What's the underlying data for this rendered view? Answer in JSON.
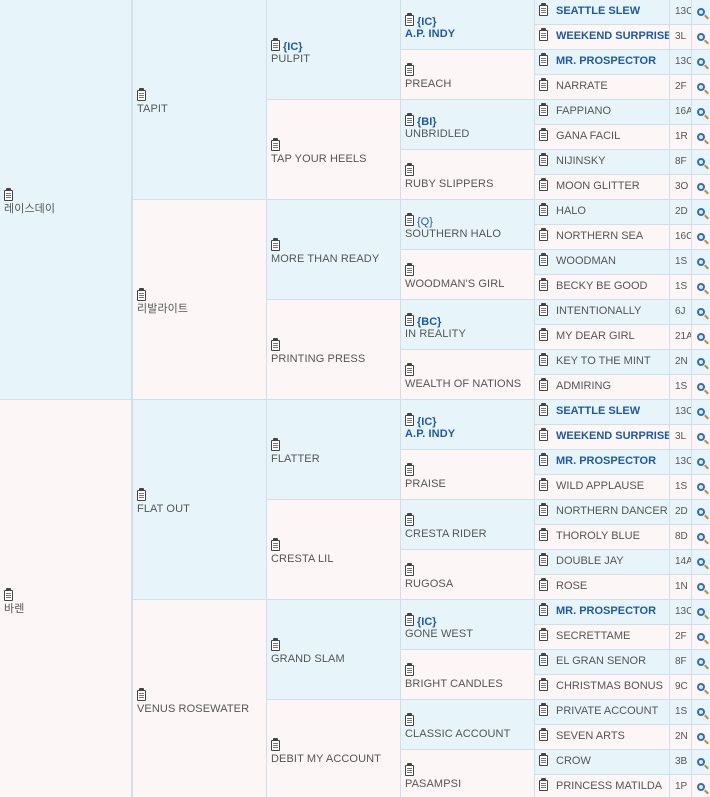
{
  "pedigree": {
    "gen1": [
      {
        "name": "레이스데이",
        "side": "sire"
      },
      {
        "name": "바렌",
        "side": "dam"
      }
    ],
    "gen2": [
      {
        "name": "TAPIT",
        "side": "sire"
      },
      {
        "name": "리발라이트",
        "side": "dam"
      },
      {
        "name": "FLAT OUT",
        "side": "sire"
      },
      {
        "name": "VENUS ROSEWATER",
        "side": "dam"
      }
    ],
    "gen3": [
      {
        "name": "PULPIT",
        "grade": "{IC}",
        "side": "sire"
      },
      {
        "name": "TAP YOUR HEELS",
        "side": "dam"
      },
      {
        "name": "MORE THAN READY",
        "side": "sire"
      },
      {
        "name": "PRINTING PRESS",
        "side": "dam"
      },
      {
        "name": "FLATTER",
        "side": "sire"
      },
      {
        "name": "CRESTA LIL",
        "side": "dam"
      },
      {
        "name": "GRAND SLAM",
        "side": "sire"
      },
      {
        "name": "DEBIT MY ACCOUNT",
        "side": "dam"
      }
    ],
    "gen4": [
      {
        "name": "A.P. INDY",
        "grade": "{IC}",
        "bold": true,
        "side": "sire"
      },
      {
        "name": "PREACH",
        "side": "dam"
      },
      {
        "name": "UNBRIDLED",
        "grade": "{BI}",
        "side": "sire"
      },
      {
        "name": "RUBY SLIPPERS",
        "side": "dam"
      },
      {
        "name": "SOUTHERN HALO",
        "grade": "{Q}",
        "gradePlain": true,
        "side": "sire"
      },
      {
        "name": "WOODMAN'S GIRL",
        "side": "dam"
      },
      {
        "name": "IN REALITY",
        "grade": "{BC}",
        "side": "sire"
      },
      {
        "name": "WEALTH OF NATIONS",
        "side": "dam"
      },
      {
        "name": "A.P. INDY",
        "grade": "{IC}",
        "bold": true,
        "side": "sire"
      },
      {
        "name": "PRAISE",
        "side": "dam"
      },
      {
        "name": "CRESTA RIDER",
        "side": "sire"
      },
      {
        "name": "RUGOSA",
        "side": "dam"
      },
      {
        "name": "GONE WEST",
        "grade": "{IC}",
        "side": "sire"
      },
      {
        "name": "BRIGHT CANDLES",
        "side": "dam"
      },
      {
        "name": "CLASSIC ACCOUNT",
        "side": "sire"
      },
      {
        "name": "PASAMPSI",
        "side": "dam"
      }
    ],
    "gen5": [
      {
        "name": "SEATTLE SLEW",
        "bold": true,
        "code": "13C",
        "side": "sire"
      },
      {
        "name": "WEEKEND SURPRISE",
        "bold": true,
        "code": "3L",
        "side": "dam"
      },
      {
        "name": "MR. PROSPECTOR",
        "bold": true,
        "code": "13C",
        "side": "sire"
      },
      {
        "name": "NARRATE",
        "code": "2F",
        "side": "dam"
      },
      {
        "name": "FAPPIANO",
        "code": "16A",
        "side": "sire"
      },
      {
        "name": "GANA FACIL",
        "code": "1R",
        "side": "dam"
      },
      {
        "name": "NIJINSKY",
        "code": "8F",
        "side": "sire"
      },
      {
        "name": "MOON GLITTER",
        "code": "3O",
        "side": "dam"
      },
      {
        "name": "HALO",
        "code": "2D",
        "side": "sire"
      },
      {
        "name": "NORTHERN SEA",
        "code": "16C",
        "side": "dam"
      },
      {
        "name": "WOODMAN",
        "code": "1S",
        "side": "sire"
      },
      {
        "name": "BECKY BE GOOD",
        "code": "1S",
        "side": "dam"
      },
      {
        "name": "INTENTIONALLY",
        "code": "6J",
        "side": "sire"
      },
      {
        "name": "MY DEAR GIRL",
        "code": "21A",
        "side": "dam"
      },
      {
        "name": "KEY TO THE MINT",
        "code": "2N",
        "side": "sire"
      },
      {
        "name": "ADMIRING",
        "code": "1S",
        "side": "dam"
      },
      {
        "name": "SEATTLE SLEW",
        "bold": true,
        "code": "13C",
        "side": "sire"
      },
      {
        "name": "WEEKEND SURPRISE",
        "bold": true,
        "code": "3L",
        "side": "dam"
      },
      {
        "name": "MR. PROSPECTOR",
        "bold": true,
        "code": "13C",
        "side": "sire"
      },
      {
        "name": "WILD APPLAUSE",
        "code": "1S",
        "side": "dam"
      },
      {
        "name": "NORTHERN DANCER",
        "code": "2D",
        "side": "sire"
      },
      {
        "name": "THOROLY BLUE",
        "code": "8D",
        "side": "dam"
      },
      {
        "name": "DOUBLE JAY",
        "code": "14A",
        "side": "sire"
      },
      {
        "name": "ROSE",
        "code": "1N",
        "side": "dam"
      },
      {
        "name": "MR. PROSPECTOR",
        "bold": true,
        "code": "13C",
        "side": "sire"
      },
      {
        "name": "SECRETTAME",
        "code": "2F",
        "side": "dam"
      },
      {
        "name": "EL GRAN SENOR",
        "code": "8F",
        "side": "sire"
      },
      {
        "name": "CHRISTMAS BONUS",
        "code": "9C",
        "side": "dam"
      },
      {
        "name": "PRIVATE ACCOUNT",
        "code": "1S",
        "side": "sire"
      },
      {
        "name": "SEVEN ARTS",
        "code": "2N",
        "side": "dam"
      },
      {
        "name": "CROW",
        "code": "3B",
        "side": "sire"
      },
      {
        "name": "PRINCESS MATILDA",
        "code": "1P",
        "side": "dam"
      }
    ]
  },
  "icons": {
    "note": "clipboard-icon",
    "search": "magnifier-icon"
  },
  "colors": {
    "sire_bg": "#e7f5fb",
    "dam_bg": "#fdf6f7",
    "link": "#1f5aa6",
    "border": "#cfe0e8"
  }
}
